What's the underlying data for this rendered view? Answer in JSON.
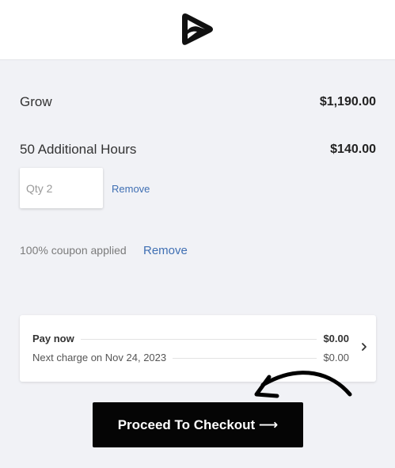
{
  "header": {
    "logo_icon": "play-logo-icon"
  },
  "line_items": [
    {
      "name": "Grow",
      "price": "$1,190.00"
    },
    {
      "name": "50 Additional Hours",
      "price": "$140.00"
    }
  ],
  "addon": {
    "qty_label": "Qty 2",
    "remove_label": "Remove"
  },
  "coupon": {
    "text": "100% coupon applied",
    "remove_label": "Remove"
  },
  "summary": {
    "pay_now_label": "Pay now",
    "pay_now_value": "$0.00",
    "next_charge_label": "Next charge on Nov 24, 2023",
    "next_charge_value": "$0.00",
    "expand_icon": "chevron-right-icon"
  },
  "checkout": {
    "label": "Proceed To Checkout ⟶"
  },
  "annotation": {
    "icon": "curved-arrow-icon"
  },
  "colors": {
    "background": "#f1f2f6",
    "link": "#3f6fb3",
    "button": "#050505"
  }
}
